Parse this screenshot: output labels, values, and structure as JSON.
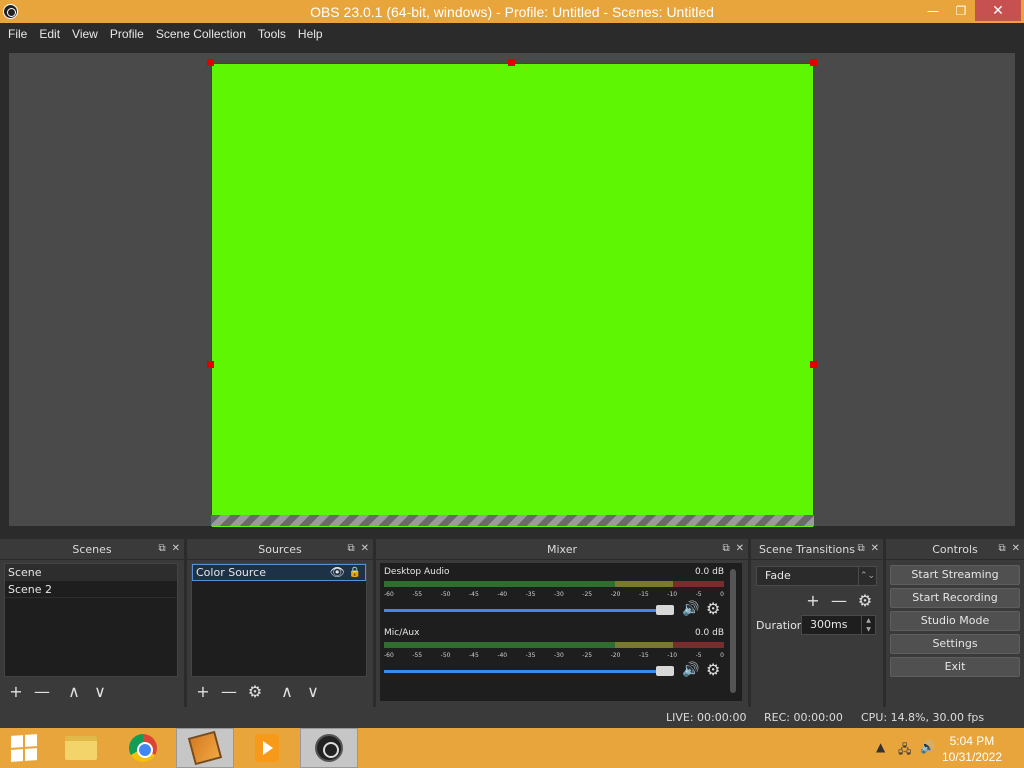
{
  "window": {
    "title": "OBS 23.0.1 (64-bit, windows) - Profile: Untitled - Scenes: Untitled",
    "minimize_glyph": "—",
    "maximize_glyph": "❐",
    "close_glyph": "✕"
  },
  "menu": [
    "File",
    "Edit",
    "View",
    "Profile",
    "Scene Collection",
    "Tools",
    "Help"
  ],
  "preview": {
    "source_color": "#5ff604",
    "selection_color": "#e00000"
  },
  "docks": {
    "scenes": {
      "title": "Scenes",
      "items": [
        "Scene",
        "Scene 2"
      ]
    },
    "sources": {
      "title": "Sources",
      "items": [
        "Color Source"
      ]
    },
    "mixer": {
      "title": "Mixer",
      "ticks": [
        "-60",
        "-55",
        "-50",
        "-45",
        "-40",
        "-35",
        "-30",
        "-25",
        "-20",
        "-15",
        "-10",
        "-5",
        "0"
      ],
      "channels": [
        {
          "name": "Desktop Audio",
          "level": "0.0 dB",
          "volume": 1.0
        },
        {
          "name": "Mic/Aux",
          "level": "0.0 dB",
          "volume": 1.0
        }
      ]
    },
    "transitions": {
      "title": "Scene Transitions",
      "selected": "Fade",
      "duration_label": "Duration",
      "duration_value": "300ms"
    },
    "controls": {
      "title": "Controls",
      "buttons": [
        "Start Streaming",
        "Start Recording",
        "Studio Mode",
        "Settings",
        "Exit"
      ]
    }
  },
  "icons": {
    "add": "+",
    "remove": "—",
    "up": "∧",
    "down": "∨",
    "gear": "⚙",
    "eye": "👁",
    "lock": "🔒",
    "speaker": "🔊",
    "float": "⧉",
    "close": "✕"
  },
  "status": {
    "live": "LIVE: 00:00:00",
    "rec": "REC: 00:00:00",
    "cpu": "CPU: 14.8%, 30.00 fps"
  },
  "taskbar": {
    "time": "5:04 PM",
    "date": "10/31/2022"
  },
  "colors": {
    "titlebar": "#e8a53c",
    "accent_blue": "#3f89ea"
  }
}
